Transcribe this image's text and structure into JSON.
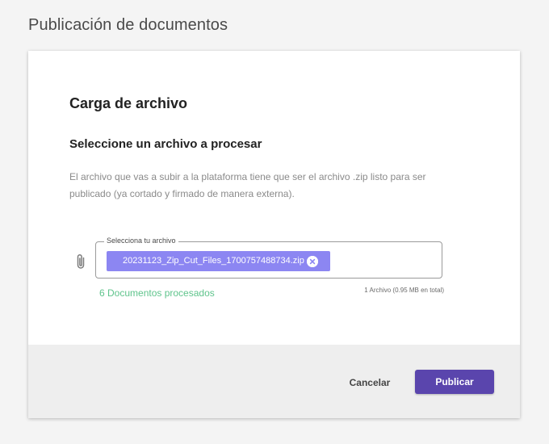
{
  "page": {
    "title": "Publicación de documentos"
  },
  "upload_card": {
    "title": "Carga de archivo",
    "subtitle": "Seleccione un archivo a procesar",
    "description": "El archivo que vas a subir a la plataforma tiene que ser el archivo .zip listo para ser publicado (ya cortado y firmado de manera externa).",
    "file_field": {
      "legend": "Selecciona tu archivo",
      "attach_icon": "paperclip-icon",
      "selected_file": {
        "name": "20231123_Zip_Cut_Files_1700757488734.zip",
        "remove_icon": "close-circle-icon"
      }
    },
    "processed_count": "6 Documentos procesados",
    "file_summary": "1 Archivo (0.95 MB en total)"
  },
  "footer": {
    "cancel_label": "Cancelar",
    "publish_label": "Publicar"
  },
  "colors": {
    "accent": "#5a45ad",
    "chip": "#8c86f2",
    "success": "#5fc48c",
    "footer_bg": "#eeeeee",
    "page_bg": "#f4f4f4"
  }
}
